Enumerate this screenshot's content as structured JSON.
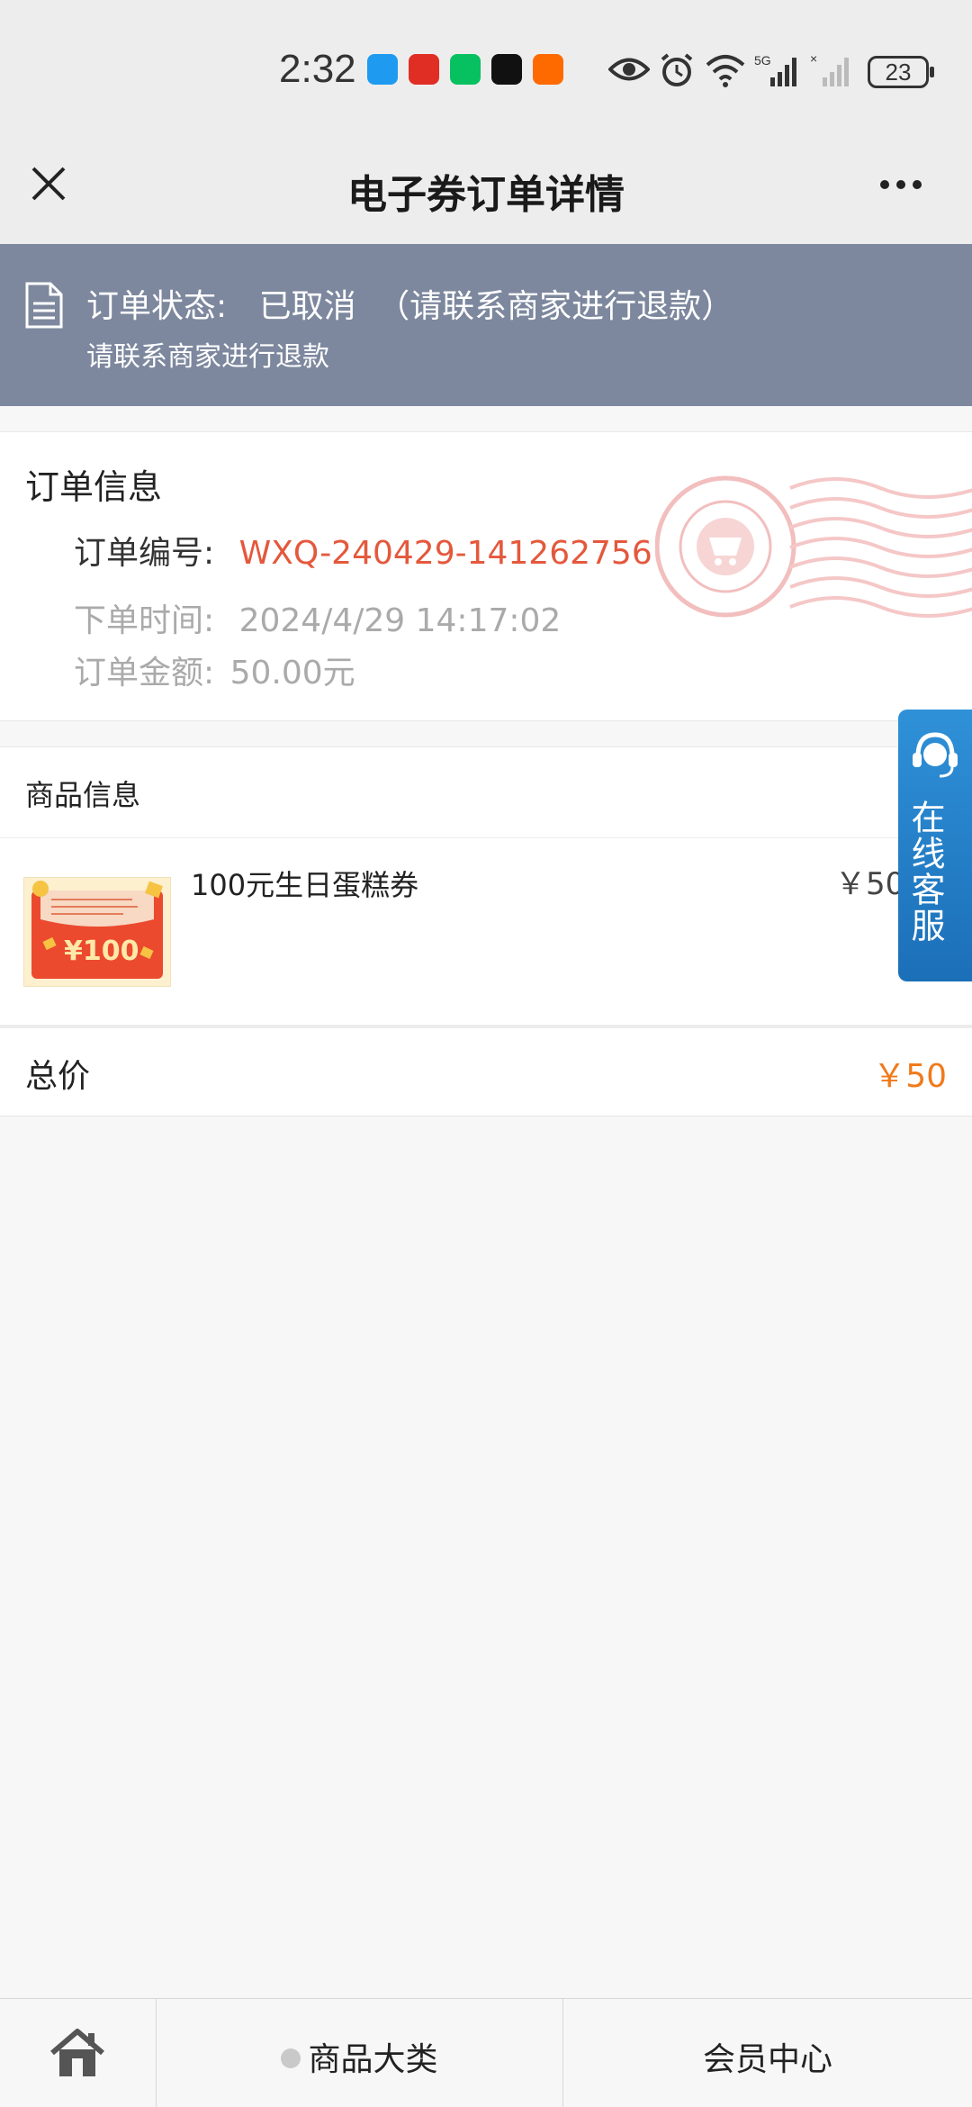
{
  "status_bar": {
    "time": "2:32",
    "battery": "23"
  },
  "nav": {
    "title": "电子券订单详情"
  },
  "banner": {
    "status_label": "订单状态:",
    "status_value": "已取消",
    "status_note": "（请联系商家进行退款）",
    "sub_text": "请联系商家进行退款"
  },
  "order_info": {
    "title": "订单信息",
    "order_no_label": "订单编号:",
    "order_no": "WXQ-240429-141262756",
    "order_time_label": "下单时间:",
    "order_time": "2024/4/29 14:17:02",
    "amount_label": "订单金额:",
    "amount": "50.00元"
  },
  "goods": {
    "title": "商品信息",
    "items": [
      {
        "name": "100元生日蛋糕券",
        "price": "￥50",
        "thumb_text": "¥100"
      }
    ]
  },
  "total": {
    "label": "总价",
    "value": "￥50"
  },
  "customer_service": {
    "label": "在线客服"
  },
  "tabbar": {
    "category": "商品大类",
    "member": "会员中心"
  },
  "colors": {
    "banner_bg": "#7d889e",
    "order_no": "#e4583c",
    "total": "#f07a1c",
    "cs_bg": "#1b6fb8"
  }
}
